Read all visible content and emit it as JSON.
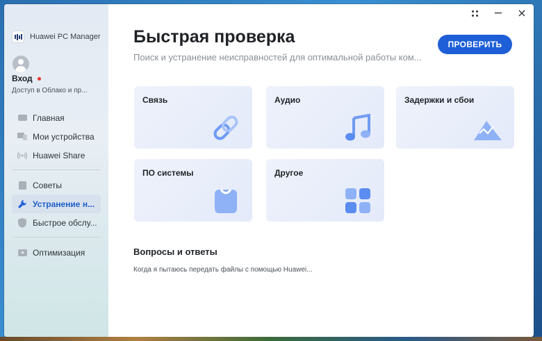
{
  "app": {
    "name": "Huawei PC Manager"
  },
  "user": {
    "login": "Вход",
    "subtitle": "Доступ в Облако и пр..."
  },
  "nav": {
    "items": [
      {
        "label": "Главная",
        "icon": "home-icon"
      },
      {
        "label": "Мои устройства",
        "icon": "devices-icon"
      },
      {
        "label": "Huawei Share",
        "icon": "share-icon"
      },
      {
        "label": "Советы",
        "icon": "tips-icon"
      },
      {
        "label": "Устранение н...",
        "icon": "wrench-icon",
        "active": true
      },
      {
        "label": "Быстрое обслу...",
        "icon": "shield-icon"
      },
      {
        "label": "Оптимизация",
        "icon": "optimize-icon"
      }
    ]
  },
  "header": {
    "title": "Быстрая проверка",
    "subtitle": "Поиск и устранение неисправностей для оптимальной работы ком...",
    "check_button": "ПРОВЕРИТЬ"
  },
  "cards": [
    {
      "label": "Связь",
      "icon": "link-icon"
    },
    {
      "label": "Аудио",
      "icon": "music-note-icon"
    },
    {
      "label": "Задержки и сбои",
      "icon": "mountain-icon"
    },
    {
      "label": "ПО системы",
      "icon": "bag-icon"
    },
    {
      "label": "Другое",
      "icon": "grid-icon"
    }
  ],
  "faq": {
    "title": "Вопросы и ответы",
    "items": [
      "Когда я пытаюсь передать файлы с помощью Huawei..."
    ]
  },
  "colors": {
    "accent": "#1e5ed6",
    "card_bg": "#e8edfa",
    "icon_blue": "#5b8df0",
    "alert_dot": "#e4342c"
  }
}
